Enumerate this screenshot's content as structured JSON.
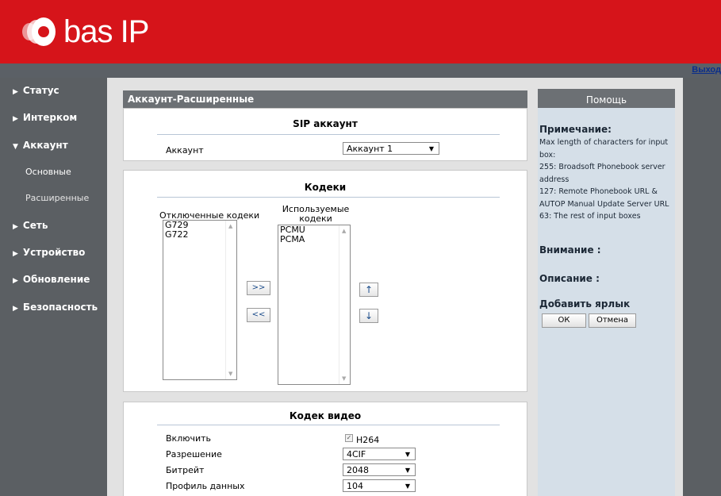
{
  "header": {
    "brand": "bas IP",
    "logout_label": "Выход"
  },
  "sidebar": {
    "items": [
      {
        "label": "Статус",
        "arrow": "▶"
      },
      {
        "label": "Интерком",
        "arrow": "▶"
      },
      {
        "label": "Аккаунт",
        "arrow": "▼"
      },
      {
        "label": "Сеть",
        "arrow": "▶"
      },
      {
        "label": "Устройство",
        "arrow": "▶"
      },
      {
        "label": "Обновление",
        "arrow": "▶"
      },
      {
        "label": "Безопасность",
        "arrow": "▶"
      }
    ],
    "sub_items": [
      "Основные",
      "Расширенные"
    ]
  },
  "page": {
    "title": "Аккаунт-Расширенные"
  },
  "sip": {
    "title": "SIP аккаунт",
    "account_label": "Аккаунт",
    "account_value": "Аккаунт 1"
  },
  "codecs": {
    "title": "Кодеки",
    "disabled_label": "Отключенные кодеки",
    "used_label_1": "Используемые",
    "used_label_2": "кодеки",
    "disabled_list": [
      "G729",
      "G722"
    ],
    "used_list": [
      "PCMU",
      "PCMA"
    ],
    "move_right": ">>",
    "move_left": "<<",
    "move_up": "↑",
    "move_down": "↓"
  },
  "video": {
    "title": "Кодек видео",
    "enable_label": "Включить",
    "enable_value": "H264",
    "enable_checked": true,
    "resolution_label": "Разрешение",
    "resolution_value": "4CIF",
    "bitrate_label": "Битрейт",
    "bitrate_value": "2048",
    "profile_label": "Профиль данных",
    "profile_value": "104"
  },
  "help": {
    "head": "Помощь",
    "note_title": "Примечание:",
    "note_lines": [
      "Max length of characters for input",
      "box:",
      "255: Broadsoft Phonebook server",
      "address",
      "127: Remote Phonebook URL &",
      "AUTOP Manual Update Server URL",
      "63: The rest of input boxes"
    ],
    "warning_title": "Внимание :",
    "description_title": "Описание :",
    "shortcut_title": "Добавить ярлык",
    "ok_label": "ОК",
    "cancel_label": "Отмена"
  },
  "colors": {
    "brand_red": "#d6141a",
    "sidebar_gray": "#5b5f63",
    "help_bg": "#d5dfe8"
  }
}
